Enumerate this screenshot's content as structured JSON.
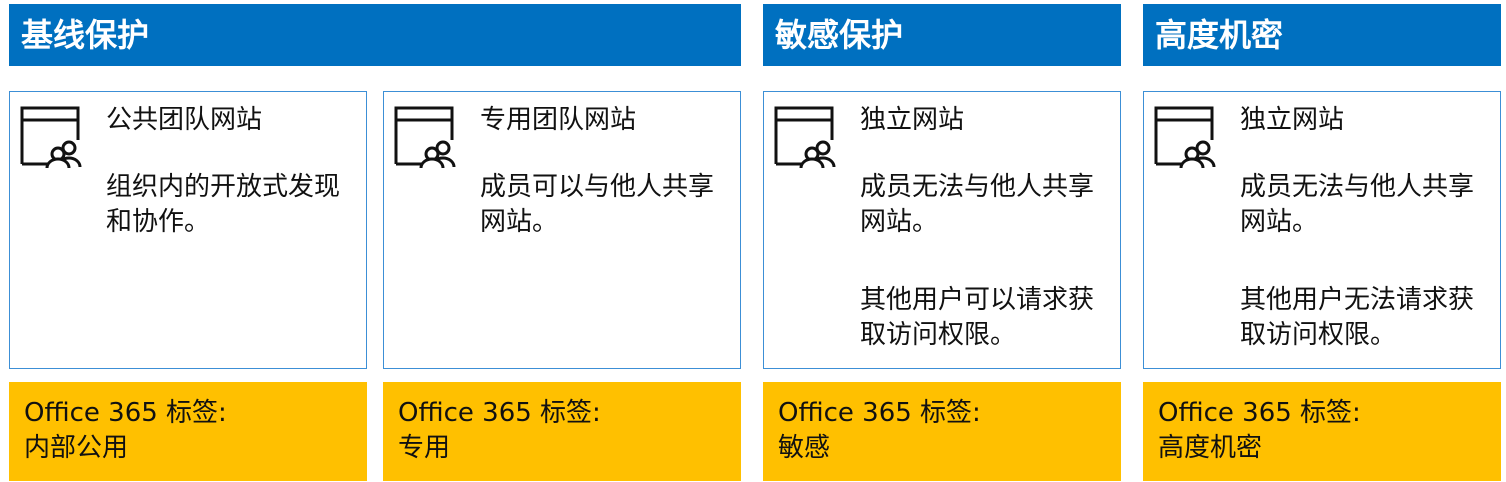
{
  "headers": {
    "baseline": "基线保护",
    "sensitive": "敏感保护",
    "confidential": "高度机密"
  },
  "cards": [
    {
      "icon": "site-members-icon",
      "title": "公共团队网站",
      "desc1": "组织内的开放式发现和协作。",
      "desc2": ""
    },
    {
      "icon": "site-members-icon",
      "title": "专用团队网站",
      "desc1": "成员可以与他人共享网站。",
      "desc2": ""
    },
    {
      "icon": "site-members-icon",
      "title": "独立网站",
      "desc1": "成员无法与他人共享网站。",
      "desc2": "其他用户可以请求获取访问权限。"
    },
    {
      "icon": "site-members-icon",
      "title": "独立网站",
      "desc1": "成员无法与他人共享网站。",
      "desc2": "其他用户无法请求获取访问权限。"
    }
  ],
  "labels": [
    {
      "prefix": "Office 365 标签:",
      "name": "内部公用"
    },
    {
      "prefix": "Office 365 标签:",
      "name": "专用"
    },
    {
      "prefix": "Office 365 标签:",
      "name": "敏感"
    },
    {
      "prefix": "Office 365 标签:",
      "name": "高度机密"
    }
  ],
  "colors": {
    "header_blue": "#0070c0",
    "card_border": "#3c8fd6",
    "label_yellow": "#ffc000"
  }
}
